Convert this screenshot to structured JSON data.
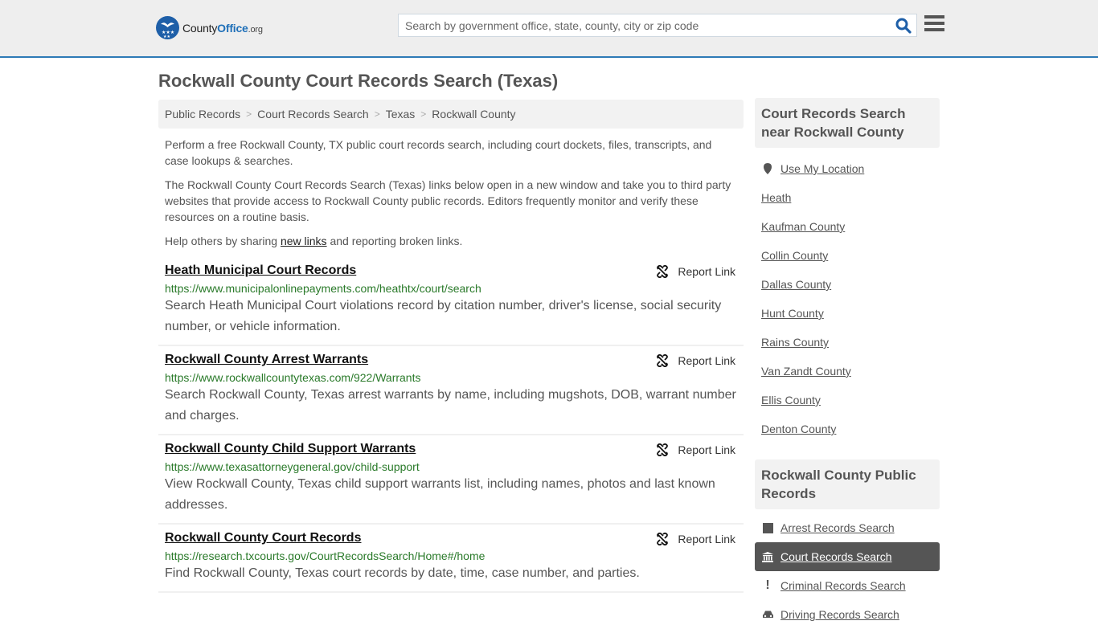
{
  "header": {
    "logo": {
      "brand_a": "County",
      "brand_b": "Office",
      "brand_c": ".org"
    },
    "search": {
      "placeholder": "Search by government office, state, county, city or zip code",
      "value": ""
    },
    "icons": {
      "search": "search-icon",
      "menu": "hamburger-menu-icon"
    }
  },
  "page": {
    "title": "Rockwall County Court Records Search (Texas)"
  },
  "breadcrumb": [
    {
      "label": "Public Records"
    },
    {
      "label": "Court Records Search"
    },
    {
      "label": "Texas"
    },
    {
      "label": "Rockwall County"
    }
  ],
  "intro": {
    "p1": "Perform a free Rockwall County, TX public court records search, including court dockets, files, transcripts, and case lookups & searches.",
    "p2": "The Rockwall County Court Records Search (Texas) links below open in a new window and take you to third party websites that provide access to Rockwall County public records. Editors frequently monitor and verify these resources on a routine basis.",
    "p3_before": "Help others by sharing ",
    "p3_link": "new links",
    "p3_after": " and reporting broken links."
  },
  "listings": [
    {
      "title": "Heath Municipal Court Records",
      "url": "https://www.municipalonlinepayments.com/heathtx/court/search",
      "description": "Search Heath Municipal Court violations record by citation number, driver's license, social security number, or vehicle information.",
      "report_label": "Report Link"
    },
    {
      "title": "Rockwall County Arrest Warrants",
      "url": "https://www.rockwallcountytexas.com/922/Warrants",
      "description": "Search Rockwall County, Texas arrest warrants by name, including mugshots, DOB, warrant number and charges.",
      "report_label": "Report Link"
    },
    {
      "title": "Rockwall County Child Support Warrants",
      "url": "https://www.texasattorneygeneral.gov/child-support",
      "description": "View Rockwall County, Texas child support warrants list, including names, photos and last known addresses.",
      "report_label": "Report Link"
    },
    {
      "title": "Rockwall County Court Records",
      "url": "https://research.txcourts.gov/CourtRecordsSearch/Home#/home",
      "description": "Find Rockwall County, Texas court records by date, time, case number, and parties.",
      "report_label": "Report Link"
    }
  ],
  "sidebar": {
    "nearby": {
      "heading": "Court Records Search near Rockwall County",
      "use_location": "Use My Location",
      "items": [
        "Heath",
        "Kaufman County",
        "Collin County",
        "Dallas County",
        "Hunt County",
        "Rains County",
        "Van Zandt County",
        "Ellis County",
        "Denton County"
      ]
    },
    "public_records": {
      "heading": "Rockwall County Public Records",
      "items": [
        {
          "label": "Arrest Records Search",
          "icon": "square-icon",
          "active": false
        },
        {
          "label": "Court Records Search",
          "icon": "courthouse-icon",
          "active": true
        },
        {
          "label": "Criminal Records Search",
          "icon": "exclamation-icon",
          "active": false
        },
        {
          "label": "Driving Records Search",
          "icon": "car-icon",
          "active": false
        }
      ]
    }
  },
  "colors": {
    "accent_blue": "#2d7ab6",
    "url_green": "#2a7a2a",
    "active_bg": "#555555"
  }
}
